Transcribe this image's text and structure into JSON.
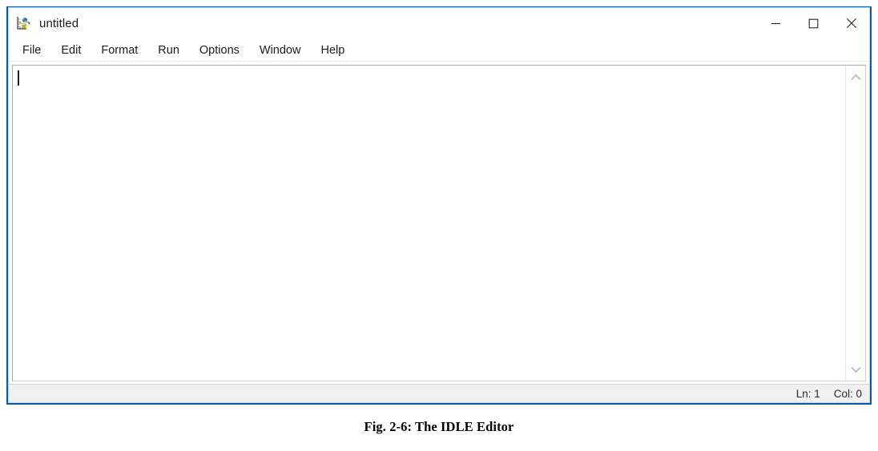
{
  "window": {
    "title": "untitled",
    "icon": "idle-python-editor-icon",
    "accent_border_color": "#0a59a8",
    "controls": [
      {
        "name": "minimize",
        "glyph": "minimize-icon",
        "label": "—"
      },
      {
        "name": "maximize",
        "glyph": "maximize-icon",
        "label": "□"
      },
      {
        "name": "close",
        "glyph": "close-icon",
        "label": "✕"
      }
    ]
  },
  "menubar": {
    "items": [
      {
        "label": "File"
      },
      {
        "label": "Edit"
      },
      {
        "label": "Format"
      },
      {
        "label": "Run"
      },
      {
        "label": "Options"
      },
      {
        "label": "Window"
      },
      {
        "label": "Help"
      }
    ]
  },
  "editor": {
    "content": "",
    "caret_visible": true,
    "background_color": "#ffffff"
  },
  "scrollbar": {
    "up_arrow": "chevron-up-icon",
    "down_arrow": "chevron-down-icon",
    "thumb_visible": false
  },
  "statusbar": {
    "line_label": "Ln: 1",
    "column_label": "Col: 0"
  },
  "figure": {
    "caption": "Fig. 2-6: The IDLE Editor"
  }
}
